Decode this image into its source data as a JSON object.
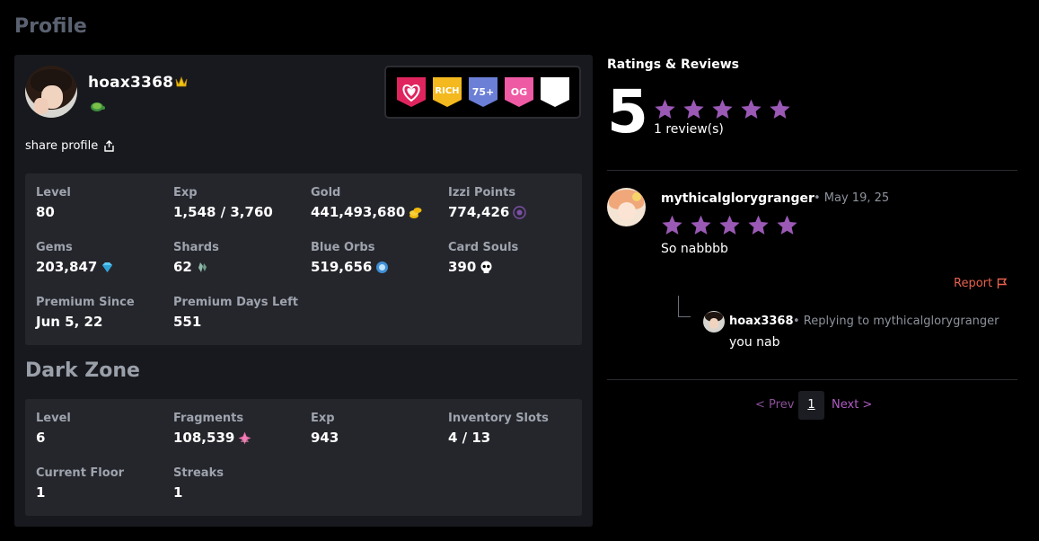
{
  "page": {
    "title": "Profile"
  },
  "profile": {
    "username": "hoax3368",
    "share_label": "share profile",
    "badges": [
      {
        "name": "heart-badge",
        "label": "",
        "color": "#e0245e"
      },
      {
        "name": "rich-badge",
        "label": "RICH",
        "color": "#f4b91e"
      },
      {
        "name": "level-75-badge",
        "label": "75+",
        "color": "#6b7fd7"
      },
      {
        "name": "og-badge",
        "label": "OG",
        "color": "#ef5aa4"
      },
      {
        "name": "blank-badge",
        "label": "",
        "color": "#ffffff"
      }
    ],
    "stats": {
      "level": {
        "label": "Level",
        "value": "80"
      },
      "exp": {
        "label": "Exp",
        "value": "1,548 / 3,760"
      },
      "gold": {
        "label": "Gold",
        "value": "441,493,680",
        "icon": "gold-coins-icon"
      },
      "izzi_points": {
        "label": "Izzi Points",
        "value": "774,426",
        "icon": "izzi-point-icon"
      },
      "gems": {
        "label": "Gems",
        "value": "203,847",
        "icon": "gem-icon"
      },
      "shards": {
        "label": "Shards",
        "value": "62",
        "icon": "shard-icon"
      },
      "blue_orbs": {
        "label": "Blue Orbs",
        "value": "519,656",
        "icon": "blue-orb-icon"
      },
      "card_souls": {
        "label": "Card Souls",
        "value": "390",
        "icon": "skull-icon"
      },
      "premium_since": {
        "label": "Premium Since",
        "value": "Jun 5, 22"
      },
      "premium_days_left": {
        "label": "Premium Days Left",
        "value": "551"
      }
    }
  },
  "dark_zone": {
    "title": "Dark Zone",
    "stats": {
      "level": {
        "label": "Level",
        "value": "6"
      },
      "fragments": {
        "label": "Fragments",
        "value": "108,539",
        "icon": "fragment-icon"
      },
      "exp": {
        "label": "Exp",
        "value": "943"
      },
      "inventory_slots": {
        "label": "Inventory Slots",
        "value": "4 / 13"
      },
      "current_floor": {
        "label": "Current Floor",
        "value": "1"
      },
      "streaks": {
        "label": "Streaks",
        "value": "1"
      }
    }
  },
  "ratings": {
    "title": "Ratings & Reviews",
    "score": "5",
    "stars": 5,
    "review_count": "1 review(s)",
    "star_color": "#9b59b6"
  },
  "review": {
    "author": "mythicalglorygranger",
    "date": "• May 19, 25",
    "stars": 5,
    "text": "So nabbbb",
    "report_label": "Report",
    "report_color": "#e8614e",
    "reply": {
      "author": "hoax3368",
      "meta": "• Replying to mythicalglorygranger",
      "text": "you nab"
    }
  },
  "pagination": {
    "prev_label": "< Prev",
    "current_page": "1",
    "next_label": "Next >"
  }
}
